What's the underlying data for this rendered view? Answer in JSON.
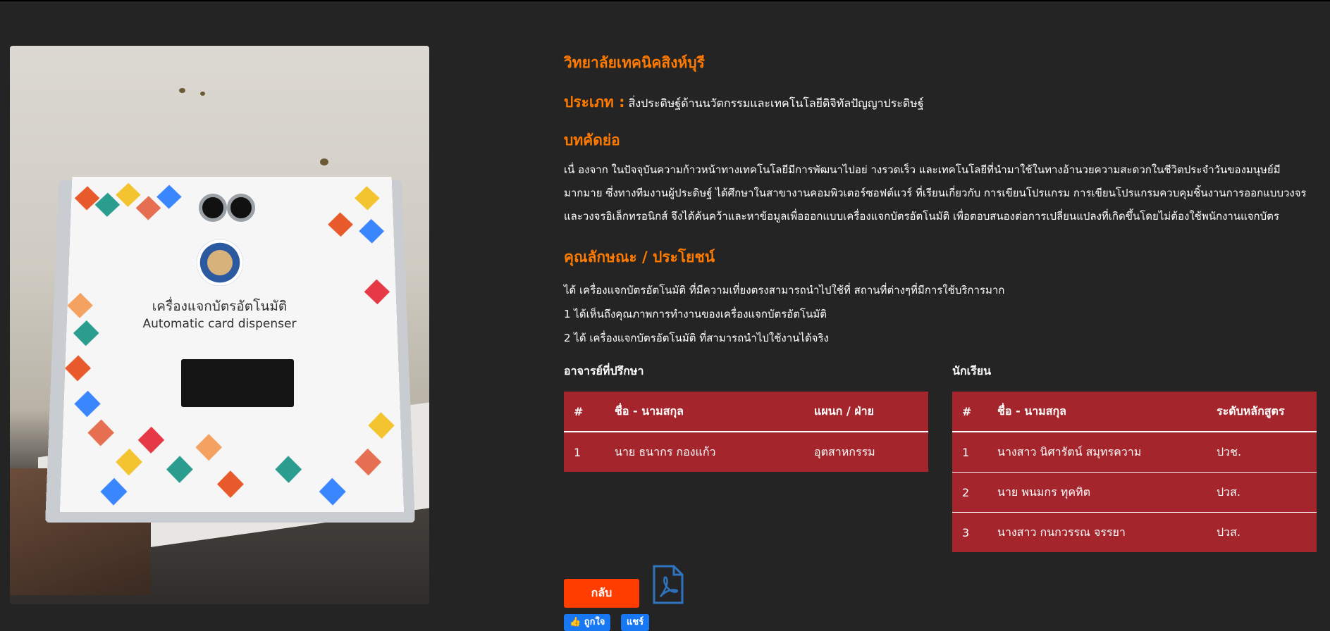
{
  "project": {
    "school": "วิทยาลัยเทคนิคสิงห์บุรี",
    "category_label": "ประเภท :",
    "category_value": "สิ่งประดิษฐ์ด้านนวัตกรรมและเทคโนโลยีดิจิทัลปัญญาประดิษฐ์",
    "abstract_heading": "บทคัดย่อ",
    "abstract_text": "เนื่ องจาก ในปัจจุบันความก้าวหน้าทางเทคโนโลยีมีการพัฒนาไปอย่ างรวดเร็ว และเทคโนโลยีที่นำมาใช้ในทางอ้านวยความสะดวกในชีวิตประจำวันของมนุษย์มีมากมาย ซึ่งทางทีมงานผู้ประดิษฐ์ ได้ศึกษาในสาขางานคอมพิวเตอร์ซอฟต์แวร์ ที่เรียนเกี่ยวกับ การเขียนโปรแกรม การเขียนโปรแกรมควบคุมชิ้นงานการออกแบบวงจร และวงจรอิเล็กทรอนิกส์ จึงได้ค้นคว้าและหาข้อมูลเพื่อออกแบบเครื่องแจกบัตรอัตโนมัติ เพื่อตอบสนองต่อการเปลี่ยนแปลงที่เกิดขึ้นโดยไม่ต้องใช้พนักงานแจกบัตร",
    "features_heading": "คุณลักษณะ / ประโยชน์",
    "features": [
      "ได้ เครื่องแจกบัตรอัตโนมัติ ที่มีความเที่ยงตรงสามารถนำไปใช้ที่ สถานที่ต่างๆที่มีการใช้บริการมาก",
      "1 ได้เห็นถึงคุณภาพการทำงานของเครื่องแจกบัตรอัตโนมัติ",
      "2 ได้ เครื่องแจกบัตรอัตโนมัติ ที่สามารถนำไปใช้งานได้จริง"
    ]
  },
  "photo": {
    "label_th": "เครื่องแจกบัตรอัตโนมัติ",
    "label_en": "Automatic card dispenser"
  },
  "advisors": {
    "title": "อาจารย์ที่ปรึกษา",
    "headers": [
      "#",
      "ชื่อ - นามสกุล",
      "แผนก / ฝ่าย"
    ],
    "rows": [
      [
        "1",
        "นาย ธนากร กองแก้ว",
        "อุตสาหกรรม"
      ]
    ]
  },
  "students": {
    "title": "นักเรียน",
    "headers": [
      "#",
      "ชื่อ - นามสกุล",
      "ระดับหลักสูตร"
    ],
    "rows": [
      [
        "1",
        "นางสาว นิศารัตน์ สมุทรความ",
        "ปวช."
      ],
      [
        "2",
        "นาย พนมกร ทุคทิต",
        "ปวส."
      ],
      [
        "3",
        "นางสาว กนกวรรณ จรรยา",
        "ปวส."
      ]
    ]
  },
  "actions": {
    "back_label": "กลับ",
    "pdf_icon": "pdf-icon",
    "like_label": "ถูกใจ",
    "share_label": "แชร์"
  },
  "colors": {
    "accent": "#ff7a00",
    "table_bg": "#a4262c",
    "back_button": "#ff3d00",
    "background": "#242424"
  }
}
